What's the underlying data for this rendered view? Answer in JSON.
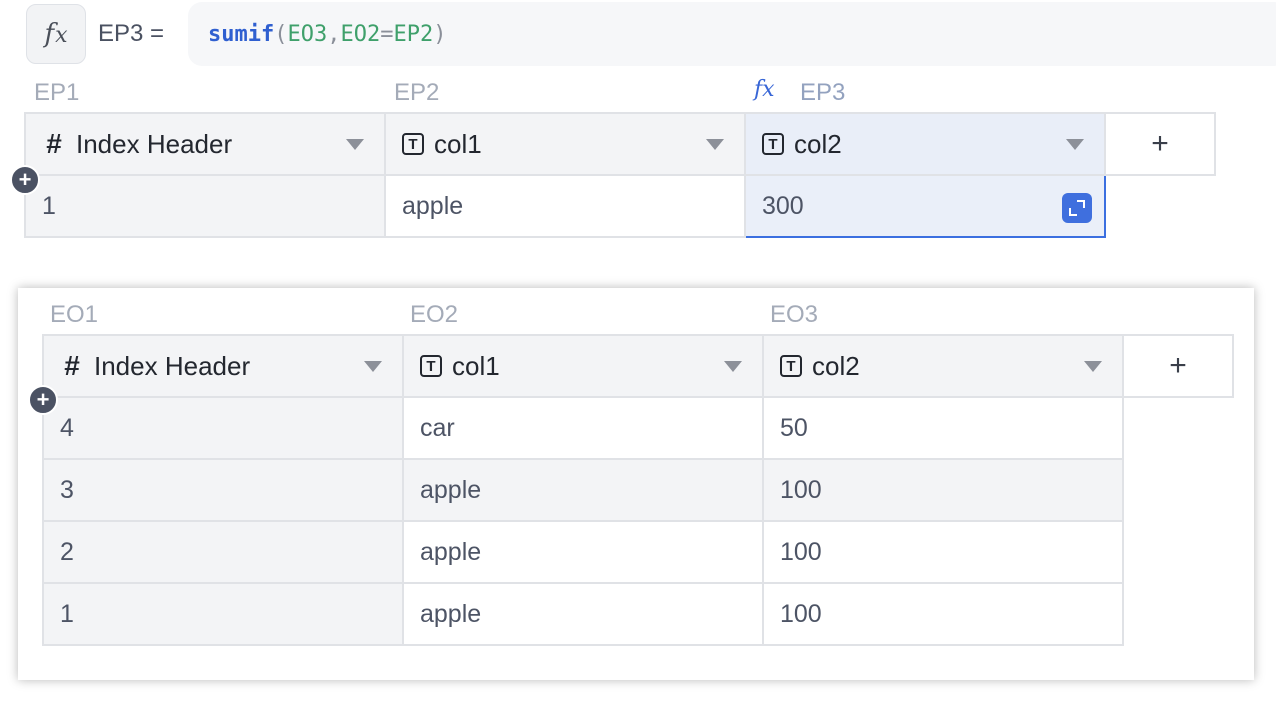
{
  "formula_bar": {
    "fx_symbol": "f",
    "fx_symbol_x": "x",
    "cell_ref": "EP3 =",
    "formula": {
      "fn": "sumif",
      "open": "(",
      "arg1": "EO3",
      "comma": ",",
      "arg2": "EO2",
      "eq": "=",
      "arg3": "EP2",
      "close": ")"
    }
  },
  "top_table": {
    "column_letters": [
      "EP1",
      "EP2",
      "EP3"
    ],
    "fx_marker": "f",
    "fx_marker_x": "x",
    "headers": [
      {
        "icon": "hash-icon",
        "icon_text": "#",
        "label": "Index Header"
      },
      {
        "icon": "text-type-icon",
        "icon_text": "T",
        "label": "col1"
      },
      {
        "icon": "text-type-icon",
        "icon_text": "T",
        "label": "col2"
      }
    ],
    "add_column": "+",
    "add_row": "+",
    "rows": [
      [
        "1",
        "apple",
        "300"
      ]
    ]
  },
  "bottom_table": {
    "column_letters": [
      "EO1",
      "EO2",
      "EO3"
    ],
    "headers": [
      {
        "icon": "hash-icon",
        "icon_text": "#",
        "label": "Index Header"
      },
      {
        "icon": "text-type-icon",
        "icon_text": "T",
        "label": "col1"
      },
      {
        "icon": "text-type-icon",
        "icon_text": "T",
        "label": "col2"
      }
    ],
    "add_column": "+",
    "add_row": "+",
    "rows": [
      [
        "4",
        "car",
        "50"
      ],
      [
        "3",
        "apple",
        "100"
      ],
      [
        "2",
        "apple",
        "100"
      ],
      [
        "1",
        "apple",
        "100"
      ]
    ]
  },
  "colors": {
    "selection": "#3b6fe0",
    "formula_fn": "#2f5fd0",
    "formula_ref": "#3fa06b"
  }
}
